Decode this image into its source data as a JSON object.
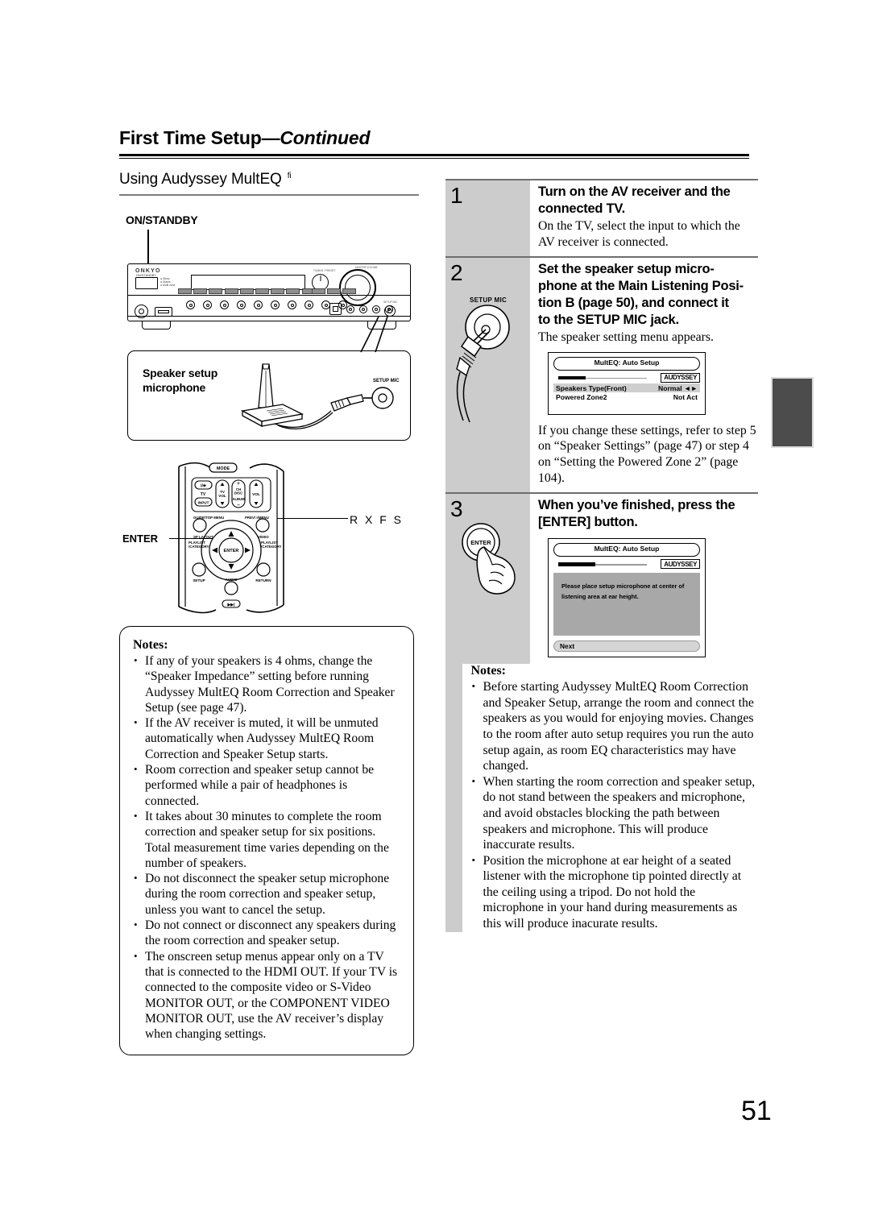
{
  "header": {
    "title_main": "First Time Setup",
    "title_dash": "—",
    "title_cont": "Continued"
  },
  "left": {
    "section_heading": "Using Audyssey MultEQ",
    "section_heading_sup": "fi",
    "onstandby_label": "ON/STANDBY",
    "receiver_brand": "ONKYO",
    "receiver_power_caption": "ON/STANDBY",
    "receiver_led_lines": "●  Sleep\n●  Status\n●  Multi zone",
    "receiver_knob_caption_small": "TUNING / PRESET",
    "receiver_knob_caption_big": "MASTER VOLUME",
    "receiver_jack_setupmic": "SETUP MIC",
    "mic_box_label_line1": "Speaker setup",
    "mic_box_label_line2": "microphone",
    "mic_box_jack_caption": "SETUP MIC",
    "remote": {
      "enter_callout": "ENTER",
      "rxfs_callout": "R X F S",
      "btn_mode": "MODE",
      "btn_power": "Ⅰ/⏻",
      "btn_tv": "TV",
      "btn_input": "INPUT",
      "btn_tvvol": "TV\nVOL",
      "btn_chdisc": "CH\nDISC",
      "btn_album": "ALBUM",
      "btn_vol": "VOL",
      "btn_guide": "GUIDE/TOP MENU",
      "btn_prev": "PREV/ I/MENU",
      "btn_splayout": "SP LAYOUT",
      "btn_video": "VIDEO",
      "btn_playlist_l": "PLAYLIST\n/CATEGORY",
      "btn_playlist_r": "PLAYLIST\n/CATEGORY",
      "btn_enter": "ENTER",
      "btn_setup": "SETUP",
      "btn_audio": "AUDIO",
      "btn_return": "RETURN"
    },
    "notes_title": "Notes:",
    "notes": [
      "If any of your speakers is 4 ohms, change the “Speaker Impedance” setting before running Audyssey MultEQ Room Correction and Speaker Setup (see page 47).",
      "If the AV receiver is muted, it will be unmuted automatically when Audyssey MultEQ Room Correction and Speaker Setup starts.",
      "Room correction and speaker setup cannot be performed while a pair of headphones is connected.",
      "It takes about 30 minutes to complete the room correction and speaker setup for six positions. Total measurement time varies depending on the number of speakers.",
      "Do not disconnect the speaker setup microphone during the room correction and speaker setup, unless you want to cancel the setup.",
      "Do not connect or disconnect any speakers during the room correction and speaker setup.",
      "The onscreen setup menus appear only on a TV that is connected to the HDMI OUT. If your TV is connected to the composite video or S-Video MONITOR OUT, or the COMPONENT VIDEO MONITOR OUT, use the AV receiver’s display when changing settings."
    ]
  },
  "right": {
    "steps": [
      {
        "number": "1",
        "title": "Turn on the AV receiver and the connected TV.",
        "body": "On the TV, select the input to which the AV receiver is connected."
      },
      {
        "number": "2",
        "title": "Set the speaker setup micro-phone at the Main Listening Posi-tion  B (page 50), and connect it to the SETUP MIC jack.",
        "title_parts": [
          "Set the speaker setup micro-",
          "phone at the Main Listening Posi-",
          "tion  B (page 50), and connect it",
          "to the SETUP MIC jack."
        ],
        "body": "The speaker setting menu appears.",
        "body2": "If you change these settings, refer to step 5 on “Speaker Settings” (page 47) or step 4 on “Setting the Powered Zone 2” (page 104).",
        "mic_label": "SETUP MIC"
      },
      {
        "number": "3",
        "title": "When you’ve finished, press the [ENTER] button.",
        "enter_button_label": "ENTER"
      }
    ],
    "screen1": {
      "title": "MultEQ: Auto Setup",
      "badge": "AUDYSSEY",
      "rows": [
        {
          "label": "Speakers Type(Front)",
          "value": "Normal ◄►",
          "highlight": true
        },
        {
          "label": "Powered Zone2",
          "value": "Not Act",
          "highlight": false
        }
      ]
    },
    "screen2": {
      "title": "MultEQ: Auto Setup",
      "badge": "AUDYSSEY",
      "message_line1": "Please place setup microphone at center of",
      "message_line2": "listening area at ear height.",
      "next_label": "Next"
    },
    "notes_title": "Notes:",
    "notes": [
      "Before starting Audyssey MultEQ Room Correction and Speaker Setup, arrange the room and connect the speakers as you would for enjoying movies. Changes to the room after auto setup requires you run the auto setup again, as room EQ characteristics may have changed.",
      "When starting the room correction and speaker setup, do not stand between the speakers and microphone, and avoid obstacles blocking the path between speakers and microphone. This will produce inaccurate results.",
      "Position the microphone at ear height of a seated listener with the microphone tip pointed directly at the ceiling using a tripod. Do not hold the microphone in your hand during measurements as this will produce inacurate results."
    ]
  },
  "page_number": "51",
  "colors": {
    "step_column_gray": "#cccccc",
    "rule_gray": "#6e6e6e",
    "tab_marker": "#4c4c4c",
    "tv_panel_gray": "#a8a8a8"
  }
}
